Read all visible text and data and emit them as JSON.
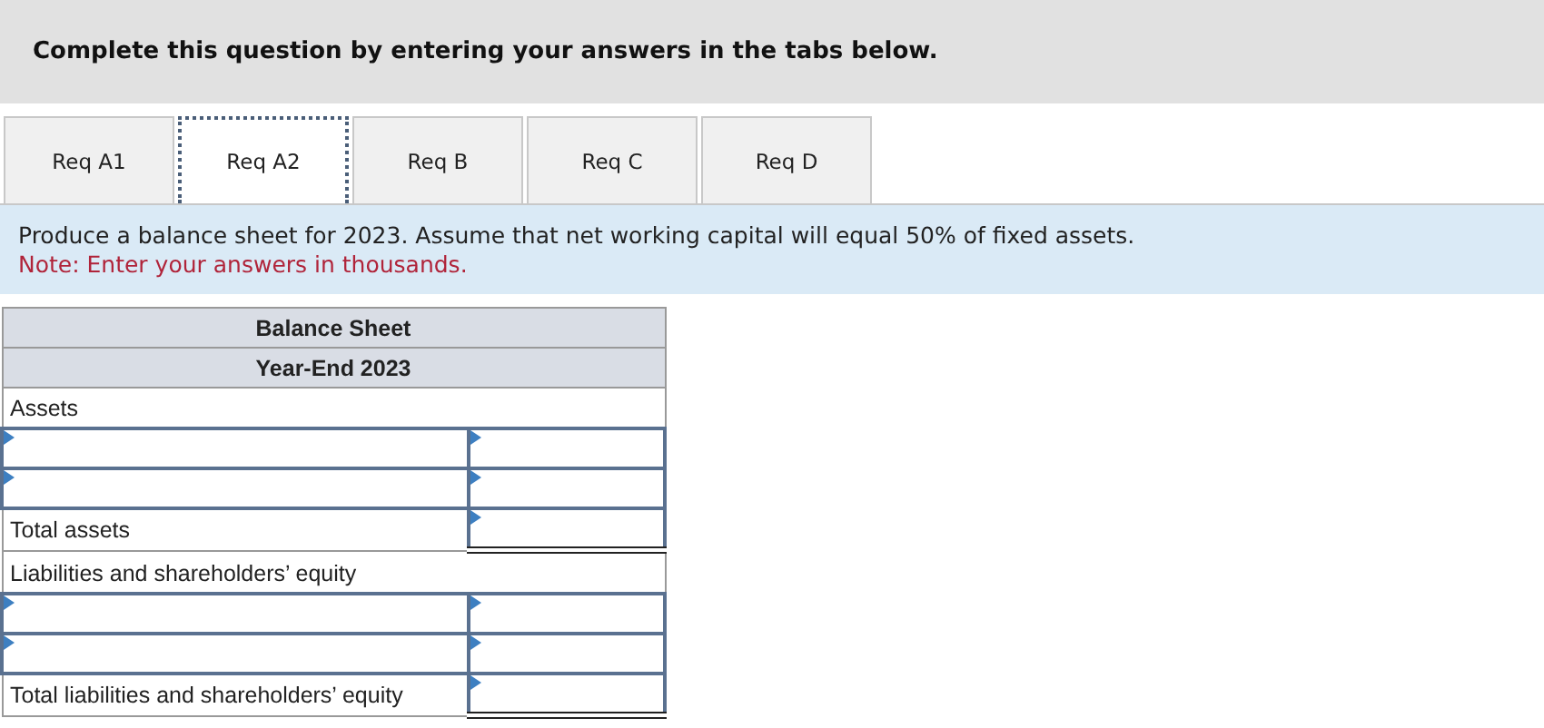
{
  "header": {
    "title": "Complete this question by entering your answers in the tabs below."
  },
  "tabs": [
    {
      "label": "Req A1",
      "selected": false
    },
    {
      "label": "Req A2",
      "selected": true
    },
    {
      "label": "Req B",
      "selected": false
    },
    {
      "label": "Req C",
      "selected": false
    },
    {
      "label": "Req D",
      "selected": false
    }
  ],
  "instructions": {
    "text": "Produce a balance sheet for 2023. Assume that net working capital will equal 50% of fixed assets.",
    "note": "Note: Enter your answers in thousands."
  },
  "table": {
    "titles": [
      "Balance Sheet",
      "Year-End 2023"
    ],
    "rows": [
      {
        "kind": "heading",
        "label": "Assets"
      },
      {
        "kind": "input"
      },
      {
        "kind": "input"
      },
      {
        "kind": "total",
        "label": "Total assets"
      },
      {
        "kind": "heading",
        "label": "Liabilities and shareholders’ equity"
      },
      {
        "kind": "input"
      },
      {
        "kind": "input"
      },
      {
        "kind": "total",
        "label": "Total liabilities and shareholders’ equity"
      }
    ]
  }
}
